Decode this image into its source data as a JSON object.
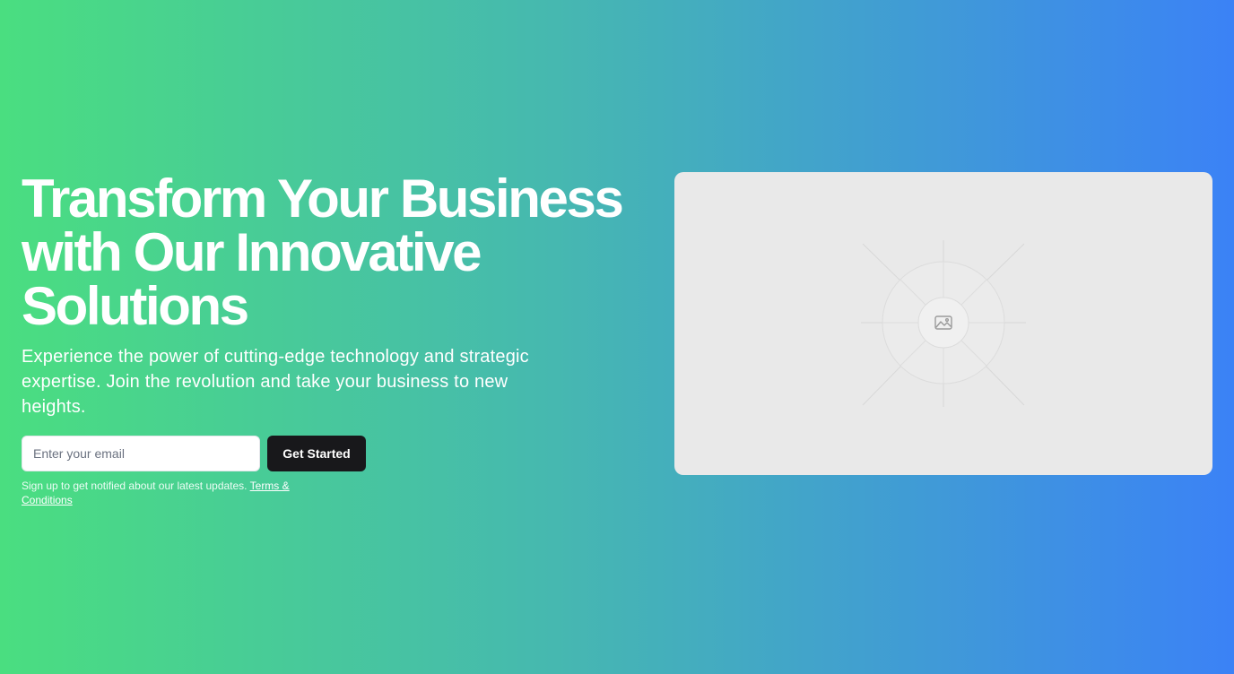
{
  "hero": {
    "headline": "Transform Your Business with Our Innovative Solutions",
    "subtext": "Experience the power of cutting-edge technology and strategic expertise. Join the revolution and take your business to new heights.",
    "email_placeholder": "Enter your email",
    "cta_label": "Get Started",
    "fineprint": "Sign up to get notified about our latest updates.",
    "terms_link": "Terms & Conditions"
  },
  "media": {
    "icon": "image-placeholder-icon"
  },
  "colors": {
    "gradient_start": "#4ade80",
    "gradient_end": "#3b82f6",
    "button_bg": "#18181b",
    "card_bg": "#e9e9e9"
  }
}
